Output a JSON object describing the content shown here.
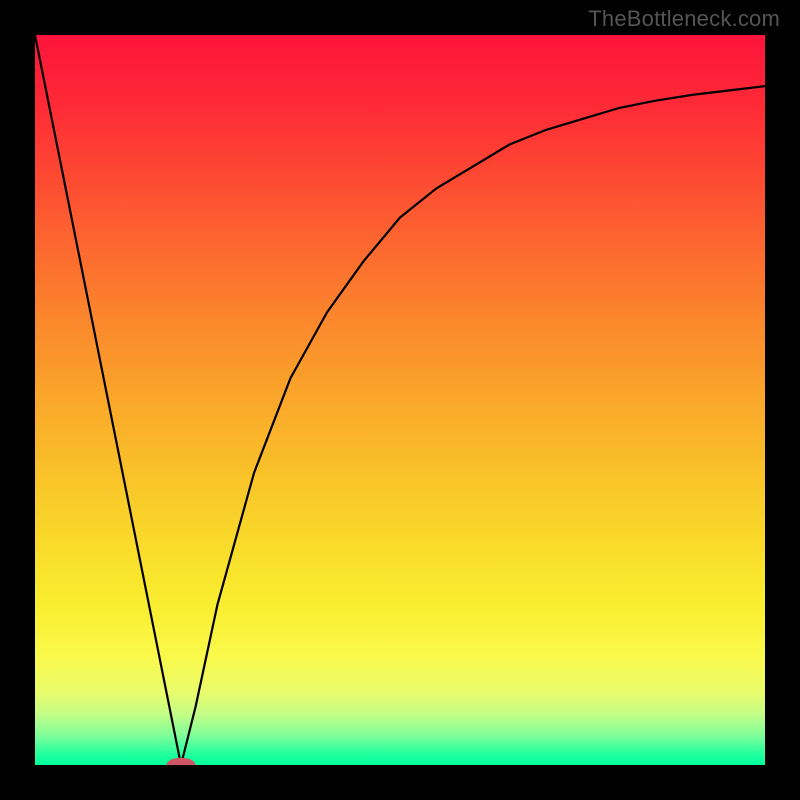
{
  "watermark": "TheBottleneck.com",
  "chart_data": {
    "type": "line",
    "title": "",
    "xlabel": "",
    "ylabel": "",
    "x_range": [
      0,
      100
    ],
    "y_range": [
      0,
      100
    ],
    "series": [
      {
        "name": "curve",
        "x": [
          0,
          5,
          10,
          15,
          18,
          20,
          22,
          25,
          30,
          35,
          40,
          45,
          50,
          55,
          60,
          65,
          70,
          75,
          80,
          85,
          90,
          95,
          100
        ],
        "y": [
          100,
          75,
          50,
          25,
          10,
          0,
          8,
          22,
          40,
          53,
          62,
          69,
          75,
          79,
          82,
          85,
          87,
          88.5,
          90,
          91,
          91.8,
          92.4,
          93
        ]
      }
    ],
    "marker": {
      "x": 20,
      "y": 0,
      "rx": 2.0,
      "ry": 1.0,
      "color": "#cf5664"
    },
    "gradient_bands": [
      {
        "pos": 0.0,
        "color": "#fe143b"
      },
      {
        "pos": 0.1,
        "color": "#fe2b36"
      },
      {
        "pos": 0.2,
        "color": "#fd4b32"
      },
      {
        "pos": 0.3,
        "color": "#fc6b2f"
      },
      {
        "pos": 0.4,
        "color": "#fb8a2c"
      },
      {
        "pos": 0.5,
        "color": "#faa72a"
      },
      {
        "pos": 0.6,
        "color": "#f9c229"
      },
      {
        "pos": 0.7,
        "color": "#f9db2a"
      },
      {
        "pos": 0.78,
        "color": "#f9ee2f"
      },
      {
        "pos": 0.85,
        "color": "#faf94a"
      },
      {
        "pos": 0.9,
        "color": "#eafc6c"
      },
      {
        "pos": 0.93,
        "color": "#c4fd86"
      },
      {
        "pos": 0.96,
        "color": "#7efe99"
      },
      {
        "pos": 0.985,
        "color": "#22ff9e"
      },
      {
        "pos": 1.0,
        "color": "#00ff99"
      }
    ]
  }
}
